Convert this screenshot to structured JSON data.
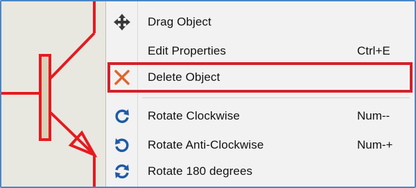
{
  "menu": {
    "items": [
      {
        "label": "Drag Object",
        "shortcut": "",
        "icon": "move-arrows-icon"
      },
      {
        "label": "Edit Properties",
        "shortcut": "Ctrl+E",
        "icon": ""
      },
      {
        "label": "Delete Object",
        "shortcut": "",
        "icon": "delete-x-icon",
        "highlighted": true
      },
      {
        "label": "Rotate Clockwise",
        "shortcut": "Num--",
        "icon": "rotate-clockwise-icon"
      },
      {
        "label": "Rotate Anti-Clockwise",
        "shortcut": "Num-+",
        "icon": "rotate-anticlockwise-icon"
      },
      {
        "label": "Rotate 180 degrees",
        "shortcut": "",
        "icon": "rotate-180-icon"
      }
    ]
  },
  "colors": {
    "highlight_border": "#d42029",
    "schematic_wire": "#e8191f",
    "icon_blue": "#1f5aa6",
    "frame_border": "#4a86c5"
  }
}
